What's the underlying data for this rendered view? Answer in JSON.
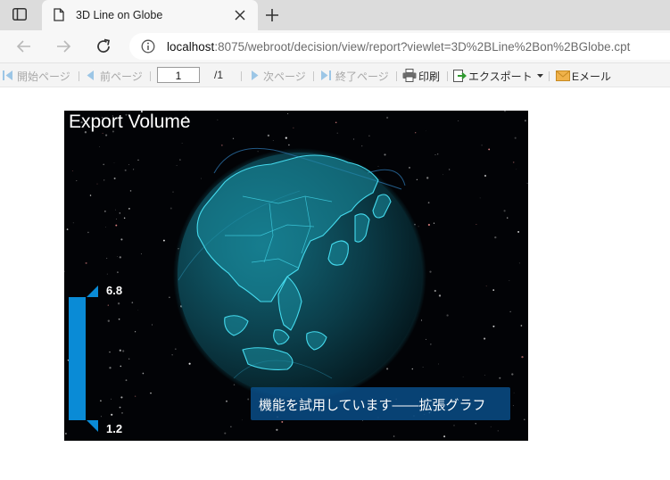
{
  "browser": {
    "tab_title": "3D Line on Globe",
    "url_host": "localhost",
    "url_rest": ":8075/webroot/decision/view/report?viewlet=3D%2BLine%2Bon%2BGlobe.cpt"
  },
  "toolbar": {
    "first_page": "開始ページ",
    "prev_page": "前ページ",
    "page_current": "1",
    "page_total": "/1",
    "next_page": "次ページ",
    "last_page": "終了ページ",
    "print": "印刷",
    "export": "エクスポート",
    "email": "Eメール"
  },
  "chart": {
    "title": "Export Volume",
    "visual_map": {
      "max": "6.8",
      "min": "1.2"
    },
    "trial_notice": "機能を試用しています——拡張グラフ",
    "colors": {
      "globe": "#0e5566",
      "land_border": "#3fd3e6",
      "range_bar": "#0a8bd6",
      "background": "#020306"
    }
  }
}
